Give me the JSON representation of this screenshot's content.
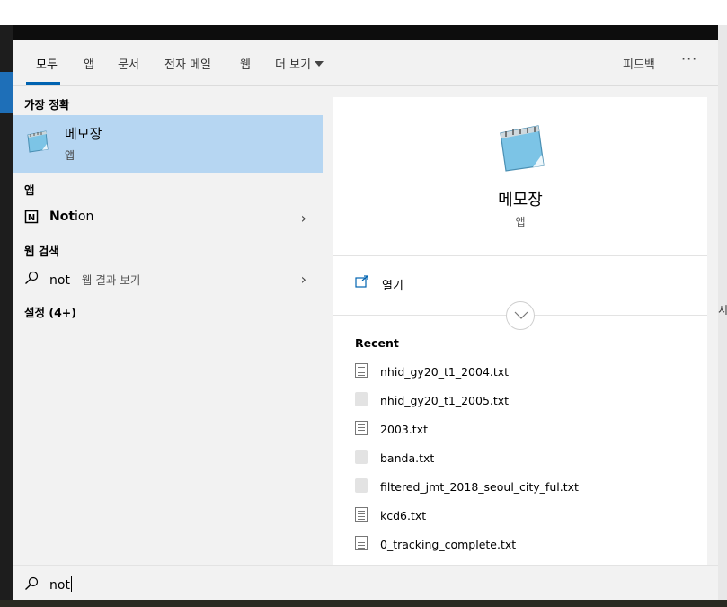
{
  "tabs": [
    {
      "label": "모두",
      "active": true
    },
    {
      "label": "앱"
    },
    {
      "label": "문서"
    },
    {
      "label": "전자 메일"
    },
    {
      "label": "웹"
    },
    {
      "label": "더 보기"
    }
  ],
  "header": {
    "feedback": "피드백",
    "more_options": "···"
  },
  "results": {
    "best_match_title": "가장 정확",
    "best_match": {
      "name": "메모장",
      "type": "앱",
      "icon": "notepad-icon"
    },
    "apps_title": "앱",
    "apps": [
      {
        "name_bold": "Not",
        "name_rest": "ion",
        "icon": "notion-icon"
      }
    ],
    "web_title": "웹 검색",
    "web": {
      "query": "not",
      "suffix": "- 웹 결과 보기"
    },
    "settings_title": "설정 (4+)"
  },
  "preview": {
    "app_name": "메모장",
    "app_type": "앱",
    "open_label": "열기",
    "recent_title": "Recent",
    "recent_files": [
      {
        "name": "nhid_gy20_t1_2004.txt",
        "icon": "doc"
      },
      {
        "name": "nhid_gy20_t1_2005.txt",
        "icon": "blank"
      },
      {
        "name": "2003.txt",
        "icon": "doc"
      },
      {
        "name": "banda.txt",
        "icon": "blank"
      },
      {
        "name": "filtered_jmt_2018_seoul_city_ful.txt",
        "icon": "blank"
      },
      {
        "name": "kcd6.txt",
        "icon": "doc"
      },
      {
        "name": "0_tracking_complete.txt",
        "icon": "doc"
      }
    ]
  },
  "search": {
    "value": "not"
  },
  "desktop": {
    "right_edge_text": "시"
  },
  "colors": {
    "accent": "#0063b1",
    "selection": "#b6d6f2",
    "panel": "#f2f2f2"
  }
}
